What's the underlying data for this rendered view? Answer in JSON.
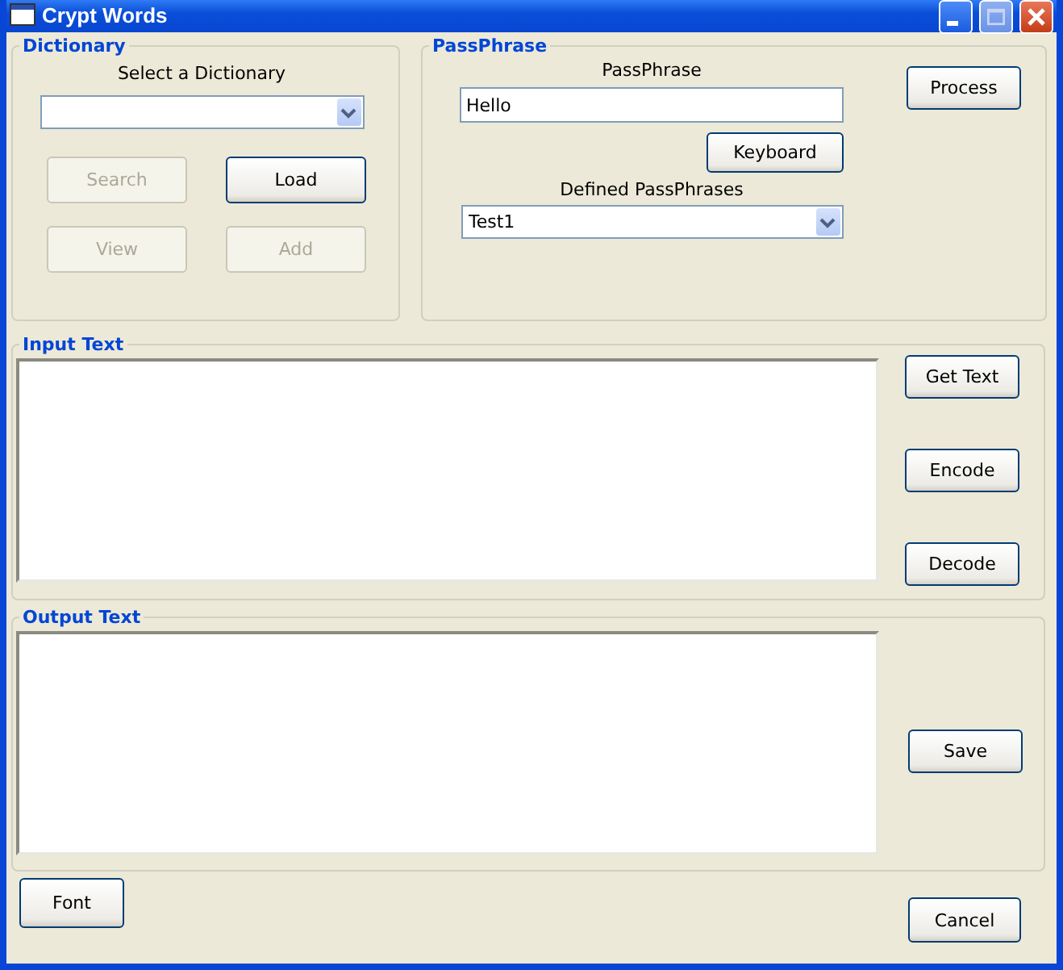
{
  "window": {
    "title": "Crypt Words"
  },
  "dictionary": {
    "title": "Dictionary",
    "label": "Select a Dictionary",
    "buttons": [
      {
        "label": "Search",
        "disabled": true
      },
      {
        "label": "Load",
        "disabled": false
      },
      {
        "label": "View",
        "disabled": true
      },
      {
        "label": "Add",
        "disabled": true
      }
    ]
  },
  "passphrase": {
    "title": "PassPhrase",
    "label": "PassPhrase",
    "value": "Hello",
    "keyboard_button": "Keyboard",
    "process_button": "Process",
    "defined_label": "Defined PassPhrases",
    "defined_value": "Test1"
  },
  "input": {
    "title": "Input Text",
    "buttons": [
      "Get Text",
      "Encode",
      "Decode"
    ]
  },
  "output": {
    "title": "Output Text",
    "buttons": [
      "Save"
    ]
  },
  "footer": {
    "font_button": "Font",
    "cancel_button": "Cancel"
  }
}
